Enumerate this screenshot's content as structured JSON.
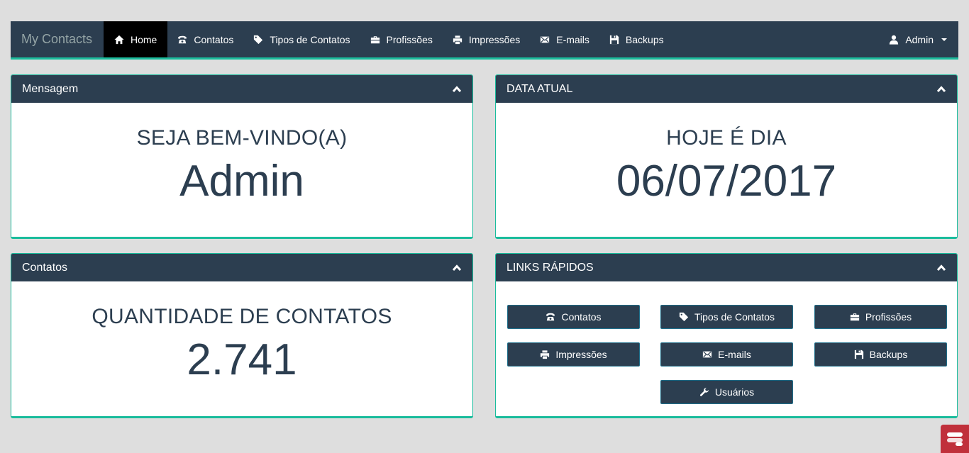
{
  "navbar": {
    "brand": "My Contacts",
    "items": [
      {
        "label": "Home",
        "icon": "home-icon",
        "active": true
      },
      {
        "label": "Contatos",
        "icon": "phone-icon"
      },
      {
        "label": "Tipos de Contatos",
        "icon": "tag-icon"
      },
      {
        "label": "Profissões",
        "icon": "briefcase-icon"
      },
      {
        "label": "Impressões",
        "icon": "print-icon"
      },
      {
        "label": "E-mails",
        "icon": "envelope-icon"
      },
      {
        "label": "Backups",
        "icon": "save-icon"
      }
    ],
    "user": {
      "label": "Admin",
      "icon": "user-icon"
    }
  },
  "panels": {
    "mensagem": {
      "title": "Mensagem",
      "label": "SEJA BEM-VINDO(A)",
      "value": "Admin"
    },
    "data": {
      "title": "DATA ATUAL",
      "label": "HOJE É DIA",
      "value": "06/07/2017"
    },
    "contatos": {
      "title": "Contatos",
      "label": "QUANTIDADE DE CONTATOS",
      "value": "2.741"
    },
    "links": {
      "title": "LINKS RÁPIDOS",
      "buttons": [
        {
          "label": "Contatos",
          "icon": "phone-icon"
        },
        {
          "label": "Tipos de Contatos",
          "icon": "tag-icon"
        },
        {
          "label": "Profissões",
          "icon": "briefcase-icon"
        },
        {
          "label": "Impressões",
          "icon": "print-icon"
        },
        {
          "label": "E-mails",
          "icon": "envelope-icon"
        },
        {
          "label": "Backups",
          "icon": "save-icon"
        },
        {
          "label": "Usuários",
          "icon": "wrench-icon"
        }
      ]
    }
  },
  "colors": {
    "navbar": "#2c3e50",
    "accent": "#1abc9c",
    "active": "#000000",
    "background": "#dedede",
    "badge": "#c0303b"
  }
}
